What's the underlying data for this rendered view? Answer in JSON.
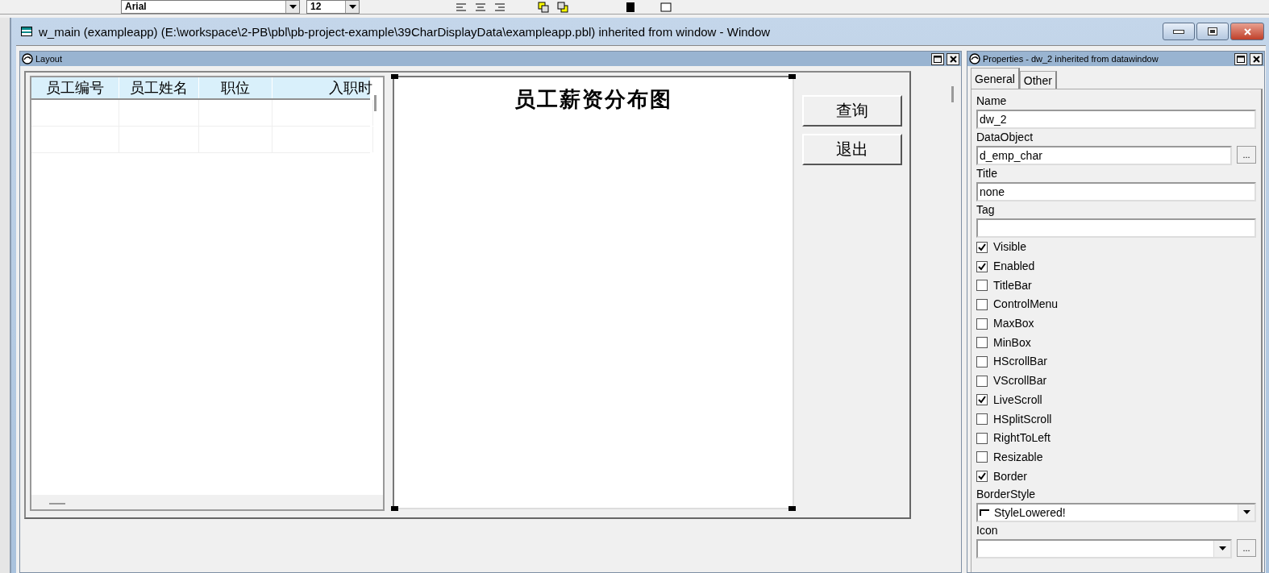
{
  "toolbar": {
    "font": "Arial",
    "size": "12"
  },
  "window": {
    "title": "w_main (exampleapp) (E:\\workspace\\2-PB\\pbl\\pb-project-example\\39CharDisplayData\\exampleapp.pbl) inherited from window - Window"
  },
  "layout": {
    "title": "Layout",
    "grid": {
      "columns": [
        "员工编号",
        "员工姓名",
        "职位",
        "入职时"
      ]
    },
    "chart": {
      "title": "员工薪资分布图"
    },
    "buttons": [
      "查询",
      "退出"
    ]
  },
  "properties": {
    "title": "Properties - dw_2 inherited from datawindow",
    "tabs": [
      {
        "label": "General",
        "selected": true
      },
      {
        "label": "Other",
        "selected": false
      }
    ],
    "items": [
      {
        "kind": "text",
        "label": "Name",
        "value": "dw_2"
      },
      {
        "kind": "browse",
        "label": "DataObject",
        "value": "d_emp_char",
        "button": "..."
      },
      {
        "kind": "text",
        "label": "Title",
        "value": "none"
      },
      {
        "kind": "text",
        "label": "Tag"
      },
      {
        "kind": "checkbox",
        "label": "Visible",
        "checked": true
      },
      {
        "kind": "checkbox",
        "label": "Enabled",
        "checked": true
      },
      {
        "kind": "checkbox",
        "label": "TitleBar",
        "checked": false
      },
      {
        "kind": "checkbox",
        "label": "ControlMenu",
        "checked": false
      },
      {
        "kind": "checkbox",
        "label": "MaxBox",
        "checked": false
      },
      {
        "kind": "checkbox",
        "label": "MinBox",
        "checked": false
      },
      {
        "kind": "checkbox",
        "label": "HScrollBar",
        "checked": false
      },
      {
        "kind": "checkbox",
        "label": "VScrollBar",
        "checked": false
      },
      {
        "kind": "checkbox",
        "label": "LiveScroll",
        "checked": true
      },
      {
        "kind": "checkbox",
        "label": "HSplitScroll",
        "checked": false
      },
      {
        "kind": "checkbox",
        "label": "RightToLeft",
        "checked": false
      },
      {
        "kind": "checkbox",
        "label": "Resizable",
        "checked": false
      },
      {
        "kind": "checkbox",
        "label": "Border",
        "checked": true
      },
      {
        "kind": "dropdown",
        "label": "BorderStyle",
        "value": "StyleLowered!"
      },
      {
        "kind": "dropdown_browse",
        "label": "Icon",
        "button": "..."
      }
    ]
  }
}
